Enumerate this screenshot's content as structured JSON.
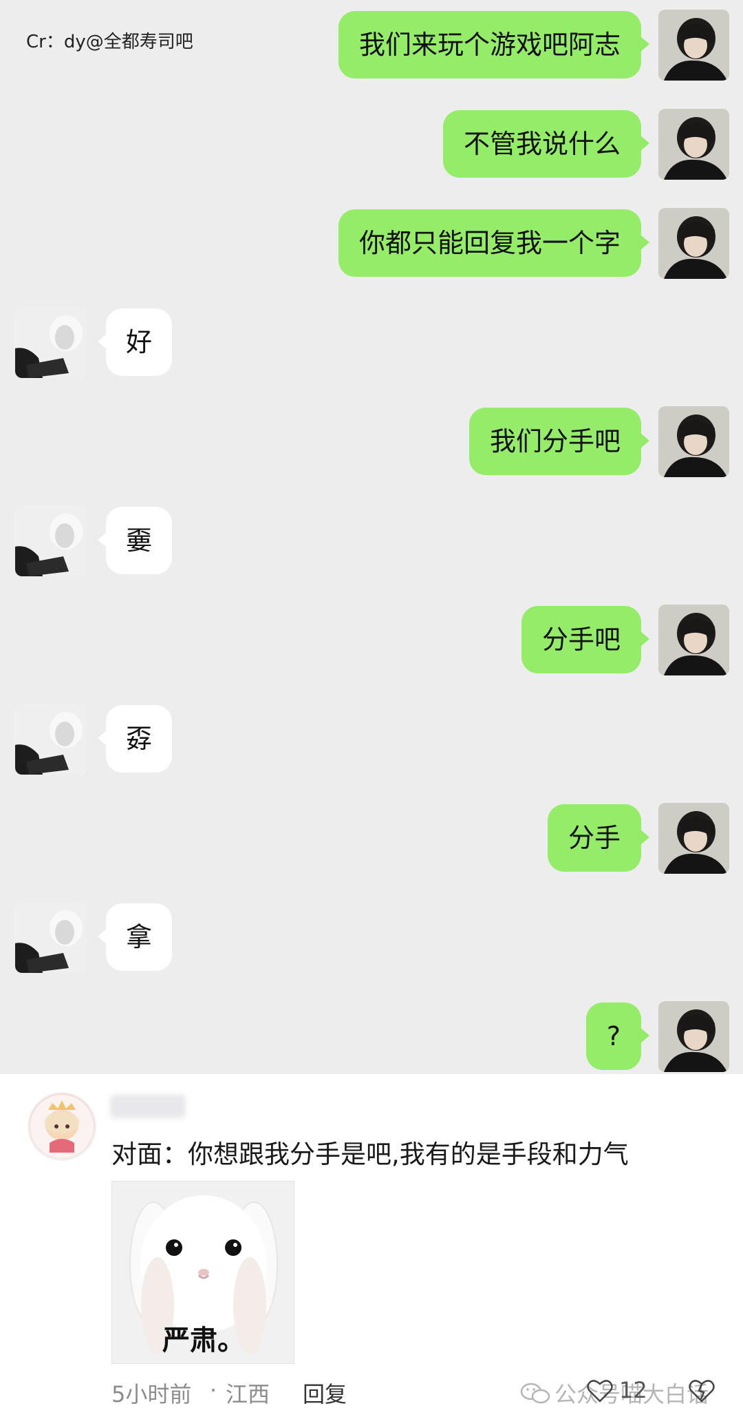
{
  "credit": "Cr：dy@全都寿司吧",
  "messages": [
    {
      "from": "me",
      "text": "我们来玩个游戏吧阿志"
    },
    {
      "from": "me",
      "text": "不管我说什么"
    },
    {
      "from": "me",
      "text": "你都只能回复我一个字"
    },
    {
      "from": "them",
      "text": "好"
    },
    {
      "from": "me",
      "text": "我们分手吧"
    },
    {
      "from": "them",
      "text": "嫑"
    },
    {
      "from": "me",
      "text": "分手吧"
    },
    {
      "from": "them",
      "text": "孬"
    },
    {
      "from": "me",
      "text": "分手"
    },
    {
      "from": "them",
      "text": "拿"
    },
    {
      "from": "me",
      "text": "?"
    }
  ],
  "comment": {
    "text": "对面：你想跟我分手是吧,我有的是手段和力气",
    "sticker_caption": "严肃。",
    "time": "5小时前",
    "separator": "·",
    "location": "江西",
    "reply_label": "回复",
    "watermark": "公众号喵大白话",
    "likes": "12"
  },
  "colors": {
    "chat_bg": "#ededed",
    "my_bubble": "#95ec69",
    "their_bubble": "#ffffff"
  }
}
